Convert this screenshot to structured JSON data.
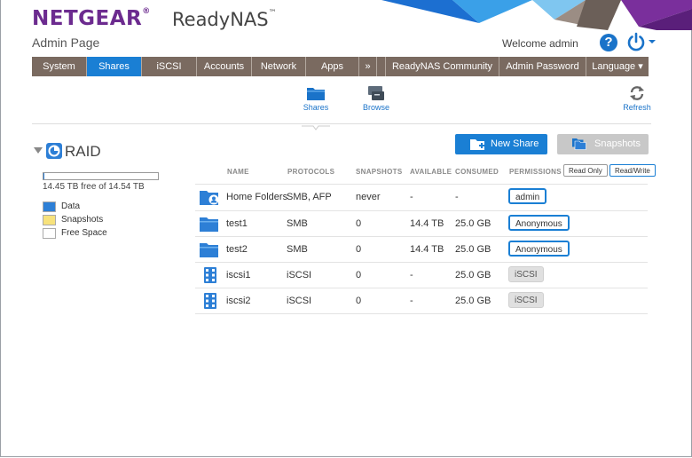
{
  "brand": {
    "logo": "NETGEAR",
    "logo_mark": "®",
    "product": "ReadyNAS",
    "product_mark": "™",
    "subtitle": "Admin Page"
  },
  "header": {
    "welcome": "Welcome admin",
    "help_glyph": "?"
  },
  "colors": {
    "accent": "#1a7fd4",
    "nav_bg": "#7a6a60",
    "brand_purple": "#6c2b8f"
  },
  "nav": [
    {
      "label": "System"
    },
    {
      "label": "Shares",
      "active": true
    },
    {
      "label": "iSCSI"
    },
    {
      "label": "Accounts"
    },
    {
      "label": "Network"
    },
    {
      "label": "Apps"
    },
    {
      "label": "»"
    },
    {
      "label": "ReadyNAS Community"
    },
    {
      "label": "Admin Password"
    },
    {
      "label": "Language ▾"
    }
  ],
  "subnav": {
    "shares": "Shares",
    "browse": "Browse",
    "refresh": "Refresh"
  },
  "volume": {
    "name": "RAID",
    "capacity_text": "14.45 TB free of 14.54 TB",
    "used_fraction": 0.006,
    "legend": [
      {
        "label": "Data",
        "color": "#2d7fd6"
      },
      {
        "label": "Snapshots",
        "color": "#f7e27c"
      },
      {
        "label": "Free Space",
        "color": "#ffffff"
      }
    ]
  },
  "actions": {
    "new_share": "New Share",
    "snapshots": "Snapshots"
  },
  "table": {
    "headers": {
      "name": "NAME",
      "protocols": "PROTOCOLS",
      "snapshots": "SNAPSHOTS",
      "available": "AVAILABLE",
      "consumed": "CONSUMED",
      "permissions": "PERMISSIONS"
    },
    "perm_filters": {
      "read_only": "Read Only",
      "read_write": "Read/Write"
    },
    "rows": [
      {
        "icon": "home-folder-icon",
        "name": "Home Folders",
        "protocols": "SMB, AFP",
        "snapshots": "never",
        "available": "-",
        "consumed": "-",
        "permission": "admin",
        "perm_type": "user"
      },
      {
        "icon": "folder-icon",
        "name": "test1",
        "protocols": "SMB",
        "snapshots": "0",
        "available": "14.4 TB",
        "consumed": "25.0 GB",
        "permission": "Anonymous",
        "perm_type": "user"
      },
      {
        "icon": "folder-icon",
        "name": "test2",
        "protocols": "SMB",
        "snapshots": "0",
        "available": "14.4 TB",
        "consumed": "25.0 GB",
        "permission": "Anonymous",
        "perm_type": "user"
      },
      {
        "icon": "lun-icon",
        "name": "iscsi1",
        "protocols": "iSCSI",
        "snapshots": "0",
        "available": "-",
        "consumed": "25.0 GB",
        "permission": "iSCSI",
        "perm_type": "iscsi"
      },
      {
        "icon": "lun-icon",
        "name": "iscsi2",
        "protocols": "iSCSI",
        "snapshots": "0",
        "available": "-",
        "consumed": "25.0 GB",
        "permission": "iSCSI",
        "perm_type": "iscsi"
      }
    ]
  }
}
